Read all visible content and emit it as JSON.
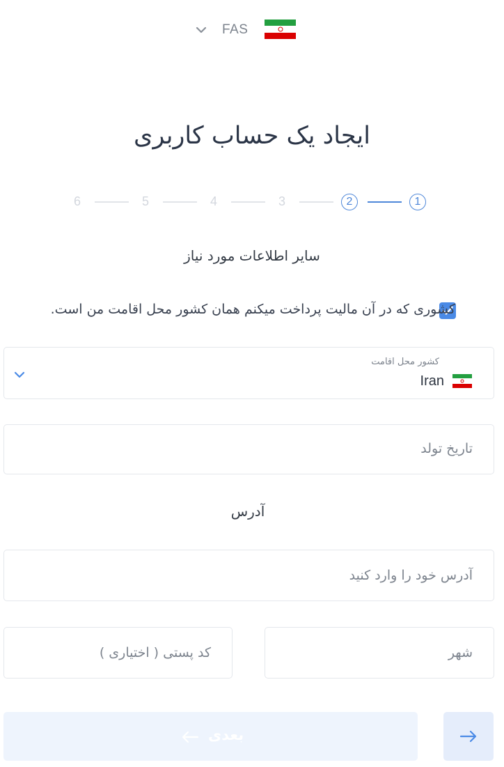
{
  "language_selector": {
    "code": "FAS",
    "flag_icon": "iran-flag-icon",
    "dropdown_icon": "chevron-down-icon"
  },
  "title": "ایجاد یک حساب کاربری",
  "stepper": {
    "steps": [
      "1",
      "2",
      "3",
      "4",
      "5",
      "6"
    ],
    "current_step": 2
  },
  "section_title": "سایر اطلاعات مورد نیاز",
  "tax_checkbox": {
    "label": "کشوری که در آن مالیت پرداخت میکنم همان کشور محل اقامت من است.",
    "checked": true
  },
  "country_field": {
    "label": "کشور محل اقامت",
    "value": "Iran"
  },
  "birth_date_field": {
    "placeholder": "تاریخ تولد"
  },
  "address_section": {
    "label": "آدرس"
  },
  "address_field": {
    "placeholder": "آدرس خود را وارد کنید"
  },
  "city_field": {
    "placeholder": "شهر"
  },
  "postal_field": {
    "placeholder": "کد پستی ( اختیاری )"
  },
  "buttons": {
    "next_label": "بعدی"
  },
  "colors": {
    "accent": "#4a8ae6",
    "next_button_bg": "#eef4fd",
    "back_button_bg": "#e5edfb"
  }
}
